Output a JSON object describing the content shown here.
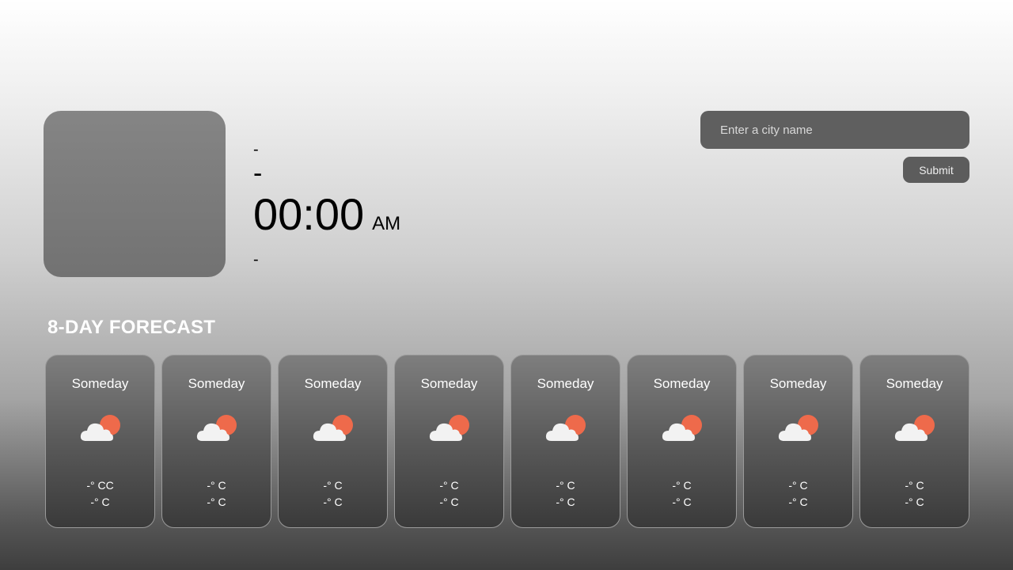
{
  "weather": {
    "line1": "-",
    "line2": "-",
    "time": "00:00",
    "ampm": "AM",
    "line3": "-"
  },
  "search": {
    "placeholder": "Enter a city name",
    "submit_label": "Submit"
  },
  "forecast": {
    "title": "8-DAY FORECAST",
    "days": [
      {
        "day": "Someday",
        "high": "-° CC",
        "low": "-° C",
        "icon": "cloud-sun-icon"
      },
      {
        "day": "Someday",
        "high": "-° C",
        "low": "-° C",
        "icon": "cloud-sun-icon"
      },
      {
        "day": "Someday",
        "high": "-° C",
        "low": "-° C",
        "icon": "cloud-sun-icon"
      },
      {
        "day": "Someday",
        "high": "-° C",
        "low": "-° C",
        "icon": "cloud-sun-icon"
      },
      {
        "day": "Someday",
        "high": "-° C",
        "low": "-° C",
        "icon": "cloud-sun-icon"
      },
      {
        "day": "Someday",
        "high": "-° C",
        "low": "-° C",
        "icon": "cloud-sun-icon"
      },
      {
        "day": "Someday",
        "high": "-° C",
        "low": "-° C",
        "icon": "cloud-sun-icon"
      },
      {
        "day": "Someday",
        "high": "-° C",
        "low": "-° C",
        "icon": "cloud-sun-icon"
      }
    ]
  },
  "colors": {
    "sun": "#ee6a4b",
    "cloud": "#f2f2f2"
  }
}
